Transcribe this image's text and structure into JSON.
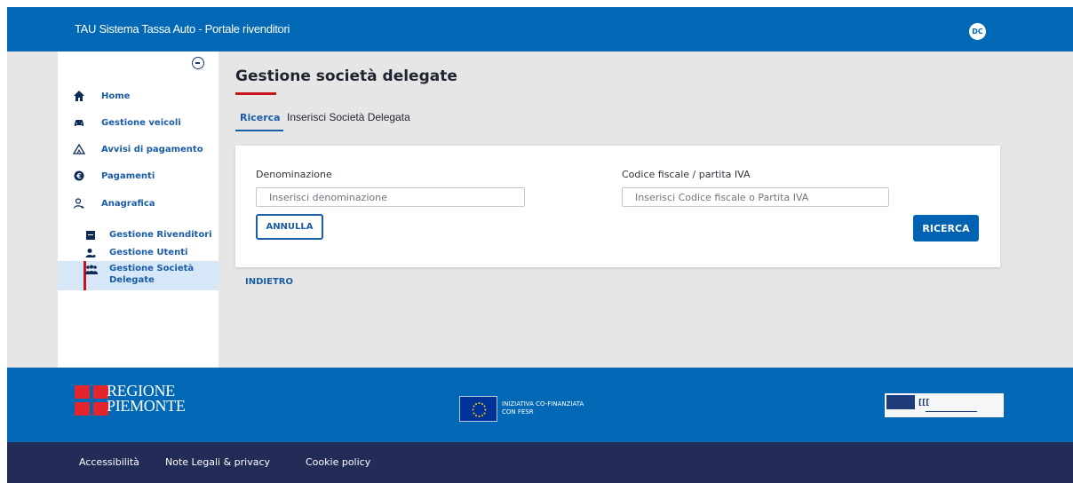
{
  "header": {
    "title": "TAU Sistema Tassa Auto - Portale rivenditori",
    "user_initials": "DC"
  },
  "sidebar": {
    "collapse_icon": "minus-circle-icon",
    "items": [
      {
        "label": "Home",
        "icon": "home-icon"
      },
      {
        "label": "Gestione veicoli",
        "icon": "car-icon"
      },
      {
        "label": "Avvisi di pagamento",
        "icon": "warning-icon"
      },
      {
        "label": "Pagamenti",
        "icon": "euro-icon"
      },
      {
        "label": "Anagrafica",
        "icon": "user-icon"
      }
    ],
    "subitems": [
      {
        "label": "Gestione Rivenditori",
        "icon": "store-icon"
      },
      {
        "label": "Gestione Utenti",
        "icon": "user-settings-icon"
      },
      {
        "label_line1": "Gestione Società",
        "label_line2": "Delegate",
        "icon": "group-icon",
        "active": true
      }
    ]
  },
  "main": {
    "title": "Gestione società delegate",
    "tabs": [
      {
        "label": "Ricerca",
        "active": true
      },
      {
        "label": "Inserisci Società Delegata",
        "active": false
      }
    ],
    "form": {
      "denominazione_label": "Denominazione",
      "denominazione_placeholder": "Inserisci denominazione",
      "codice_label": "Codice fiscale / partita IVA",
      "codice_placeholder": "Inserisci Codice fiscale o Partita IVA",
      "annulla_label": "ANNULLA",
      "ricerca_label": "RICERCA"
    },
    "back_label": "INDIETRO"
  },
  "footer": {
    "regione_line1": "REGIONE",
    "regione_line2": "PIEMONTE",
    "eu_line1": "INIZIATIVA CO-FINANZIATA",
    "eu_line2": "CON FESR",
    "links": [
      "Accessibilità",
      "Note Legali & privacy",
      "Cookie policy"
    ]
  },
  "colors": {
    "primary": "#0068b5",
    "footer_dark": "#232b57",
    "accent_red": "#c4161c",
    "link_blue": "#1a5ca6"
  }
}
